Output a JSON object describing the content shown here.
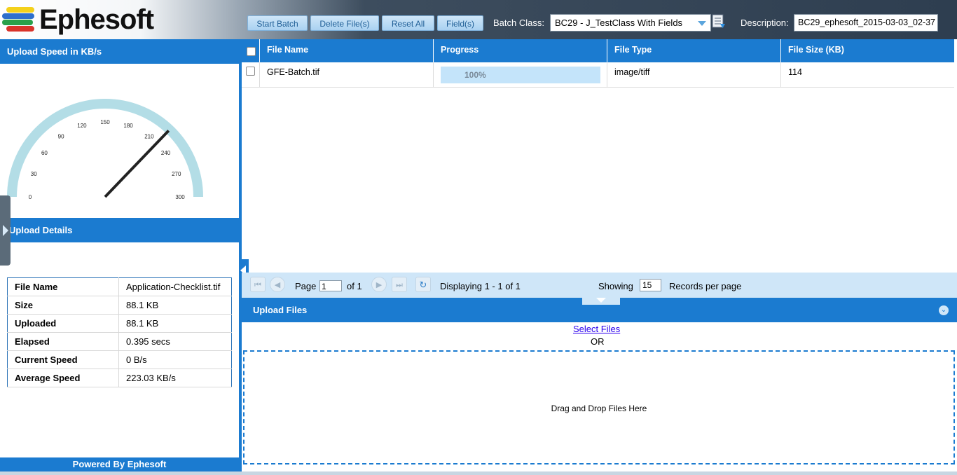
{
  "header": {
    "app_name": "Ephesoft",
    "buttons": {
      "start_batch": "Start Batch",
      "delete_files": "Delete File(s)",
      "reset_all": "Reset All",
      "fields": "Field(s)"
    },
    "batch_class_label": "Batch Class:",
    "batch_class_value": "BC29 - J_TestClass With Fields",
    "description_label": "Description:",
    "description_value": "BC29_ephesoft_2015-03-03_02-37"
  },
  "speed_panel": {
    "title": "Upload Speed in KB/s",
    "gauge": {
      "min": 0,
      "max": 300,
      "ticks": [
        "0",
        "30",
        "60",
        "90",
        "120",
        "150",
        "180",
        "210",
        "240",
        "270",
        "300"
      ],
      "value": 223.03
    }
  },
  "details_panel": {
    "title": "Upload Details",
    "rows": [
      {
        "label": "File Name",
        "value": "Application-Checklist.tif"
      },
      {
        "label": "Size",
        "value": "88.1 KB"
      },
      {
        "label": "Uploaded",
        "value": "88.1 KB"
      },
      {
        "label": "Elapsed",
        "value": "0.395 secs"
      },
      {
        "label": "Current Speed",
        "value": "0 B/s"
      },
      {
        "label": "Average Speed",
        "value": "223.03 KB/s"
      }
    ],
    "footer": "Powered By Ephesoft"
  },
  "grid": {
    "columns": [
      "File Name",
      "Progress",
      "File Type",
      "File Size (KB)"
    ],
    "rows": [
      {
        "file_name": "GFE-Batch.tif",
        "progress": 100,
        "progress_label": "100%",
        "file_type": "image/tiff",
        "file_size": "114"
      }
    ]
  },
  "pager": {
    "page_label": "Page",
    "page_value": "1",
    "of_label": "of 1",
    "displaying": "Displaying 1 - 1 of 1",
    "showing_label": "Showing",
    "records_value": "15",
    "records_label": "Records per page"
  },
  "upload": {
    "title": "Upload Files",
    "select_files": "Select Files",
    "or_text": "OR",
    "drop_text": "Drag and Drop Files Here"
  },
  "colors": {
    "accent": "#1b7bd0",
    "gauge_arc": "#b3dde6",
    "light": "#cfe6f8"
  }
}
